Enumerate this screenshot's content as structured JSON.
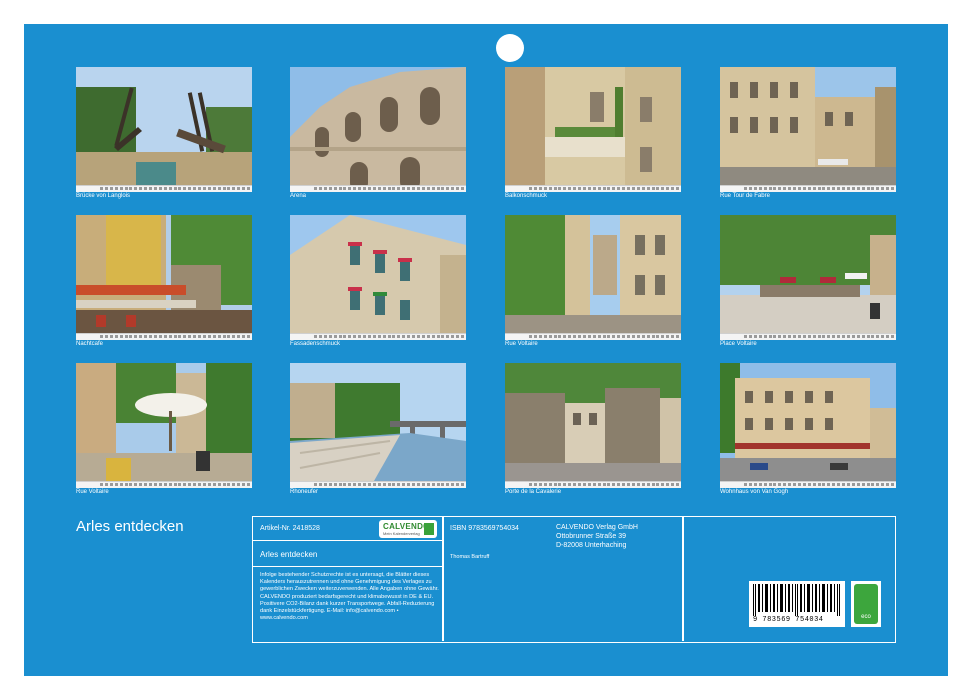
{
  "calendar": {
    "title": "Arles entdecken"
  },
  "photos": [
    {
      "caption": "Brücke von Langlois"
    },
    {
      "caption": "Arena"
    },
    {
      "caption": "Balkonschmuck"
    },
    {
      "caption": "Rue Tour de Fabre"
    },
    {
      "caption": "Nachtcafe"
    },
    {
      "caption": "Fassadenschmuck"
    },
    {
      "caption": "Rue Voltaire"
    },
    {
      "caption": "Place Voltaire"
    },
    {
      "caption": "Rue Voltaire"
    },
    {
      "caption": "Rhoneufer"
    },
    {
      "caption": "Porte de la Cavalerie"
    },
    {
      "caption": "Wohnhaus von Van Gogh"
    }
  ],
  "info": {
    "article_no": "Artikel-Nr. 2418528",
    "product_title": "Arles entdecken",
    "isbn": "ISBN 9783569754034",
    "author": "Thomas Bartruff",
    "publisher_name": "CALVENDO Verlag GmbH",
    "publisher_street": "Ottobrunner Straße 39",
    "publisher_city": "D-82008 Unterhaching",
    "legal_text": "Infolge bestehender Schutzrechte ist es untersagt, die Blätter dieses Kalenders herauszutrennen und ohne Genehmigung des Verlages zu gewerblichen Zwecken weiterzuverwenden. Alle Angaben ohne Gewähr. CALVENDO produziert bedarfsgerecht und klimabewusst in DE & EU. Positivere CO2-Bilanz dank kurzer Transportwege. Abfall-Reduzierung dank Einzelstückfertigung. E-Mail: info@calvendo.com • www.calvendo.com",
    "barcode_number": "9 783569 754034",
    "logo_text": "CALVENDO",
    "logo_sub": "Mein Kalenderverlag",
    "eco_label": "eco"
  },
  "colors": {
    "page_background": "#1a8fd0",
    "text": "#ffffff"
  }
}
